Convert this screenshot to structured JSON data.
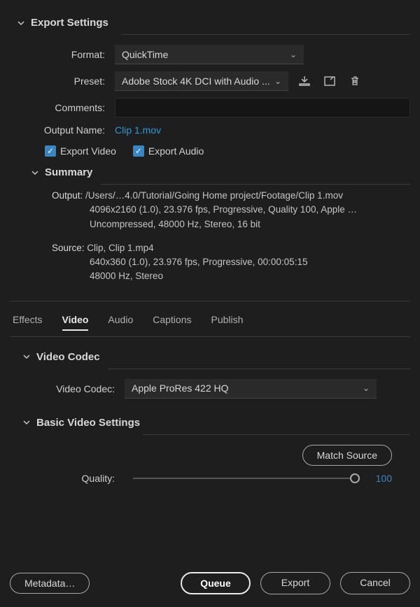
{
  "header": {
    "title": "Export Settings"
  },
  "format": {
    "label": "Format:",
    "value": "QuickTime"
  },
  "preset": {
    "label": "Preset:",
    "value": "Adobe Stock 4K DCI with Audio ..."
  },
  "comments": {
    "label": "Comments:",
    "value": ""
  },
  "output_name": {
    "label": "Output Name:",
    "value": "Clip 1.mov"
  },
  "export_video_label": "Export Video",
  "export_audio_label": "Export Audio",
  "summary": {
    "title": "Summary",
    "output_label": "Output:",
    "output_path": "/Users/…4.0/Tutorial/Going Home project/Footage/Clip 1.mov",
    "output_line2": "4096x2160 (1.0), 23.976 fps, Progressive, Quality 100, Apple …",
    "output_line3": "Uncompressed, 48000 Hz, Stereo, 16 bit",
    "source_label": "Source:",
    "source_line1": "Clip, Clip 1.mp4",
    "source_line2": "640x360 (1.0), 23.976 fps, Progressive, 00:00:05:15",
    "source_line3": "48000 Hz, Stereo"
  },
  "tabs": {
    "effects": "Effects",
    "video": "Video",
    "audio": "Audio",
    "captions": "Captions",
    "publish": "Publish"
  },
  "video_codec_section": "Video Codec",
  "video_codec": {
    "label": "Video Codec:",
    "value": "Apple ProRes 422 HQ"
  },
  "basic_video_section": "Basic Video Settings",
  "match_source": "Match Source",
  "quality": {
    "label": "Quality:",
    "value": "100"
  },
  "buttons": {
    "metadata": "Metadata…",
    "queue": "Queue",
    "export": "Export",
    "cancel": "Cancel"
  }
}
